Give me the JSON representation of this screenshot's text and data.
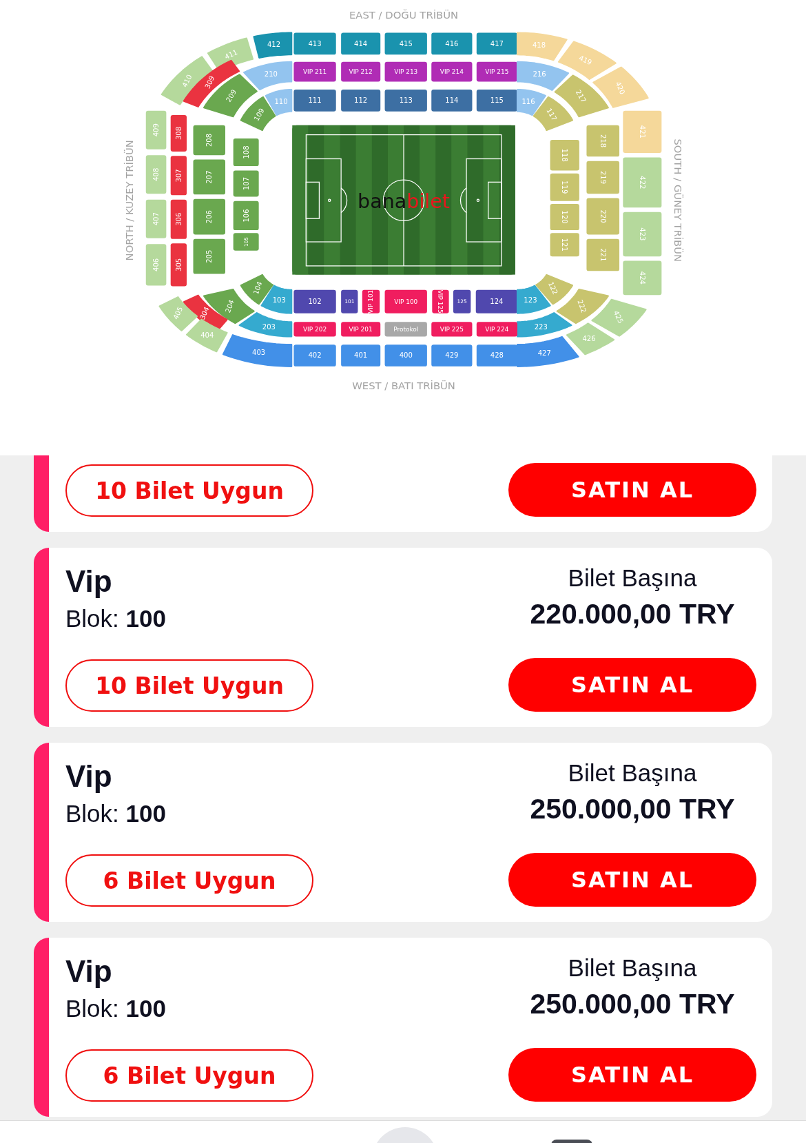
{
  "map": {
    "top_label": "EAST / DOĞU TRİBÜN",
    "bottom_label": "WEST / BATI TRİBÜN",
    "left_label": "NORTH / KUZEY TRİBÜN",
    "right_label": "SOUTH / GÜNEY TRİBÜN",
    "logo": [
      "bana",
      "bilet"
    ],
    "sections": [
      {
        "label": "410",
        "color": "#b5d99c"
      },
      {
        "label": "411",
        "color": "#b5d99c"
      },
      {
        "label": "412",
        "color": "#1a93ae"
      },
      {
        "label": "413",
        "color": "#1a93ae"
      },
      {
        "label": "414",
        "color": "#1a93ae"
      },
      {
        "label": "415",
        "color": "#1a93ae"
      },
      {
        "label": "416",
        "color": "#1a93ae"
      },
      {
        "label": "417",
        "color": "#1a93ae"
      },
      {
        "label": "418",
        "color": "#f5d89a"
      },
      {
        "label": "419",
        "color": "#f5d89a"
      },
      {
        "label": "420",
        "color": "#f5d89a"
      },
      {
        "label": "309",
        "color": "#ea3340"
      },
      {
        "label": "209",
        "color": "#6aa84f"
      },
      {
        "label": "210",
        "color": "#93c4ef"
      },
      {
        "label": "VIP 211",
        "color": "#b02cb5"
      },
      {
        "label": "VIP 212",
        "color": "#b02cb5"
      },
      {
        "label": "VIP 213",
        "color": "#b02cb5"
      },
      {
        "label": "VIP 214",
        "color": "#b02cb5"
      },
      {
        "label": "VIP 215",
        "color": "#b02cb5"
      },
      {
        "label": "216",
        "color": "#93c4ef"
      },
      {
        "label": "217",
        "color": "#c8c46e"
      },
      {
        "label": "109",
        "color": "#6aa84f"
      },
      {
        "label": "110",
        "color": "#93c4ef"
      },
      {
        "label": "111",
        "color": "#3d6fa3"
      },
      {
        "label": "112",
        "color": "#3d6fa3"
      },
      {
        "label": "113",
        "color": "#3d6fa3"
      },
      {
        "label": "114",
        "color": "#3d6fa3"
      },
      {
        "label": "115",
        "color": "#3d6fa3"
      },
      {
        "label": "116",
        "color": "#93c4ef"
      },
      {
        "label": "117",
        "color": "#c8c46e"
      },
      {
        "label": "409",
        "color": "#b5d99c"
      },
      {
        "label": "408",
        "color": "#b5d99c"
      },
      {
        "label": "407",
        "color": "#b5d99c"
      },
      {
        "label": "406",
        "color": "#b5d99c"
      },
      {
        "label": "308",
        "color": "#ea3340"
      },
      {
        "label": "307",
        "color": "#ea3340"
      },
      {
        "label": "306",
        "color": "#ea3340"
      },
      {
        "label": "305",
        "color": "#ea3340"
      },
      {
        "label": "208",
        "color": "#6aa84f"
      },
      {
        "label": "207",
        "color": "#6aa84f"
      },
      {
        "label": "206",
        "color": "#6aa84f"
      },
      {
        "label": "205",
        "color": "#6aa84f"
      },
      {
        "label": "108",
        "color": "#6aa84f"
      },
      {
        "label": "107",
        "color": "#6aa84f"
      },
      {
        "label": "106",
        "color": "#6aa84f"
      },
      {
        "label": "105",
        "color": "#6aa84f"
      },
      {
        "label": "118",
        "color": "#c8c46e"
      },
      {
        "label": "119",
        "color": "#c8c46e"
      },
      {
        "label": "120",
        "color": "#c8c46e"
      },
      {
        "label": "121",
        "color": "#c8c46e"
      },
      {
        "label": "218",
        "color": "#c8c46e"
      },
      {
        "label": "219",
        "color": "#c8c46e"
      },
      {
        "label": "220",
        "color": "#c8c46e"
      },
      {
        "label": "221",
        "color": "#c8c46e"
      },
      {
        "label": "421",
        "color": "#f5d89a"
      },
      {
        "label": "422",
        "color": "#b5d99c"
      },
      {
        "label": "423",
        "color": "#b5d99c"
      },
      {
        "label": "424",
        "color": "#b5d99c"
      },
      {
        "label": "104",
        "color": "#6aa84f"
      },
      {
        "label": "103",
        "color": "#35aacf"
      },
      {
        "label": "204",
        "color": "#6aa84f"
      },
      {
        "label": "203",
        "color": "#35aacf"
      },
      {
        "label": "304",
        "color": "#ea3340"
      },
      {
        "label": "405",
        "color": "#b5d99c"
      },
      {
        "label": "404",
        "color": "#b5d99c"
      },
      {
        "label": "403",
        "color": "#4290e8"
      },
      {
        "label": "102",
        "color": "#5048ae"
      },
      {
        "label": "101",
        "color": "#5048ae"
      },
      {
        "label": "VIP 101",
        "color": "#f01d5f"
      },
      {
        "label": "VIP 100",
        "color": "#f01d5f"
      },
      {
        "label": "VIP 125",
        "color": "#f01d5f"
      },
      {
        "label": "125",
        "color": "#5048ae"
      },
      {
        "label": "124",
        "color": "#5048ae"
      },
      {
        "label": "123",
        "color": "#35aacf"
      },
      {
        "label": "122",
        "color": "#c8c46e"
      },
      {
        "label": "223",
        "color": "#35aacf"
      },
      {
        "label": "222",
        "color": "#c8c46e"
      },
      {
        "label": "425",
        "color": "#b5d99c"
      },
      {
        "label": "426",
        "color": "#b5d99c"
      },
      {
        "label": "427",
        "color": "#4290e8"
      },
      {
        "label": "VIP 202",
        "color": "#f01d5f"
      },
      {
        "label": "VIP 201",
        "color": "#f01d5f"
      },
      {
        "label": "Protokol",
        "color": "#a8a8a8"
      },
      {
        "label": "VIP 225",
        "color": "#f01d5f"
      },
      {
        "label": "VIP 224",
        "color": "#f01d5f"
      },
      {
        "label": "402",
        "color": "#4290e8"
      },
      {
        "label": "401",
        "color": "#4290e8"
      },
      {
        "label": "400",
        "color": "#4290e8"
      },
      {
        "label": "429",
        "color": "#4290e8"
      },
      {
        "label": "428",
        "color": "#4290e8"
      }
    ]
  },
  "listings": [
    {
      "availability": "10 Bilet Uygun",
      "button": "SATIN AL"
    },
    {
      "title": "Vip",
      "block": "Blok: **100**",
      "price_label": "Bilet Başına",
      "price": "220.000,00 TRY",
      "availability": "10 Bilet Uygun",
      "button": "SATIN AL"
    },
    {
      "title": "Vip",
      "block": "Blok: **100**",
      "price_label": "Bilet Başına",
      "price": "250.000,00 TRY",
      "availability": "6 Bilet Uygun",
      "button": "SATIN AL"
    },
    {
      "title": "Vip",
      "block": "Blok: **100**",
      "price_label": "Bilet Başına",
      "price": "250.000,00 TRY",
      "availability": "6 Bilet Uygun",
      "button": "SATIN AL"
    }
  ]
}
